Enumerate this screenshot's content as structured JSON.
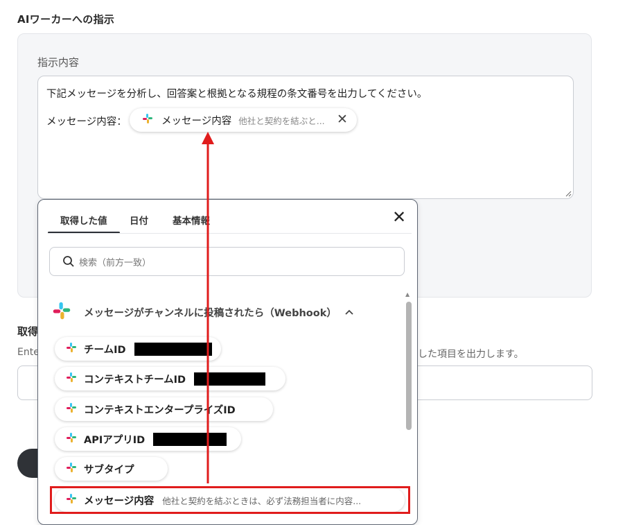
{
  "section_title": "AIワーカーへの指示",
  "instruction": {
    "label": "指示内容",
    "line1": "下記メッセージを分析し、回答案と根拠となる規程の条文番号を出力してください。",
    "line2_label": "メッセージ内容：",
    "token": {
      "icon": "slack-icon",
      "name": "メッセージ内容",
      "preview": "他社と契約を結ぶと..."
    }
  },
  "second_field": {
    "label": "取得",
    "desc_prefix": "Ente",
    "desc_tail": "した項目を出力します。"
  },
  "dropdown": {
    "tabs": [
      {
        "label": "取得した値",
        "active": true
      },
      {
        "label": "日付",
        "active": false
      },
      {
        "label": "基本情報",
        "active": false
      }
    ],
    "search_placeholder": "検索（前方一致）",
    "group_title": "メッセージがチャンネルに投稿されたら（Webhook）",
    "items": [
      {
        "label": "チームID",
        "redacted": true,
        "preview": ""
      },
      {
        "label": "コンテキストチームID",
        "redacted": true,
        "preview": ""
      },
      {
        "label": "コンテキストエンタープライズID",
        "redacted": false,
        "preview": ""
      },
      {
        "label": "APIアプリID",
        "redacted": true,
        "preview": ""
      },
      {
        "label": "サブタイプ",
        "redacted": false,
        "preview": ""
      },
      {
        "label": "メッセージ内容",
        "redacted": false,
        "preview": "他社と契約を結ぶときは、必ず法務担当者に内容..."
      }
    ]
  },
  "colors": {
    "highlight": "#e01c1c",
    "arrow": "#e01c1c",
    "panel_bg": "#f5f6f8"
  }
}
